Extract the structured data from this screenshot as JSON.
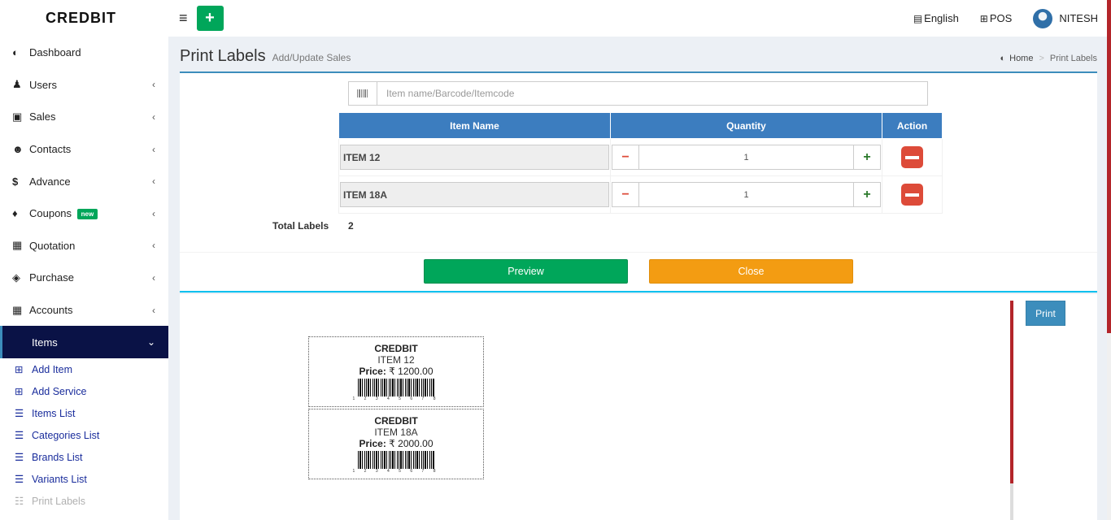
{
  "brand": "CREDBIT",
  "header": {
    "language": "English",
    "pos": "POS",
    "user": "NITESH"
  },
  "sidebar": {
    "items": [
      {
        "label": "Dashboard",
        "icon": "dashboard-icon"
      },
      {
        "label": "Users",
        "icon": "user-plus-icon"
      },
      {
        "label": "Sales",
        "icon": "cart-icon"
      },
      {
        "label": "Contacts",
        "icon": "users-icon"
      },
      {
        "label": "Advance",
        "icon": "dollar-icon"
      },
      {
        "label": "Coupons",
        "icon": "tags-icon",
        "badge": "new"
      },
      {
        "label": "Quotation",
        "icon": "calendar-icon"
      },
      {
        "label": "Purchase",
        "icon": "cube-icon"
      },
      {
        "label": "Accounts",
        "icon": "grid-icon"
      },
      {
        "label": "Items",
        "icon": "none"
      }
    ],
    "subitems": [
      {
        "label": "Add Item",
        "icon": "plus-square-icon"
      },
      {
        "label": "Add Service",
        "icon": "plus-square-icon"
      },
      {
        "label": "Items List",
        "icon": "list-icon"
      },
      {
        "label": "Categories List",
        "icon": "list-icon"
      },
      {
        "label": "Brands List",
        "icon": "list-icon"
      },
      {
        "label": "Variants List",
        "icon": "list-icon"
      },
      {
        "label": "Print Labels",
        "icon": "barcode-icon"
      }
    ]
  },
  "page": {
    "title": "Print Labels",
    "subtitle": "Add/Update Sales",
    "breadcrumb": {
      "home": "Home",
      "current": "Print Labels"
    }
  },
  "search": {
    "placeholder": "Item name/Barcode/Itemcode"
  },
  "table": {
    "headers": [
      "Item Name",
      "Quantity",
      "Action"
    ],
    "rows": [
      {
        "name": "ITEM 12",
        "qty": "1"
      },
      {
        "name": "ITEM 18A",
        "qty": "1"
      }
    ]
  },
  "totals": {
    "label": "Total Labels",
    "value": "2"
  },
  "buttons": {
    "preview": "Preview",
    "close": "Close",
    "print": "Print"
  },
  "labels": [
    {
      "store": "CREDBIT",
      "item": "ITEM 12",
      "price_label": "Price:",
      "price": "₹ 1200.00",
      "digits": "1 2 3 4 5 6 7 8"
    },
    {
      "store": "CREDBIT",
      "item": "ITEM 18A",
      "price_label": "Price:",
      "price": "₹ 2000.00",
      "digits": "1 2 3 4 5 6 7 8"
    }
  ],
  "colors": {
    "accent": "#3c8dbc",
    "green": "#00a65a",
    "orange": "#f39c12",
    "danger": "#dd4b39",
    "active_nav": "#0a1246"
  }
}
